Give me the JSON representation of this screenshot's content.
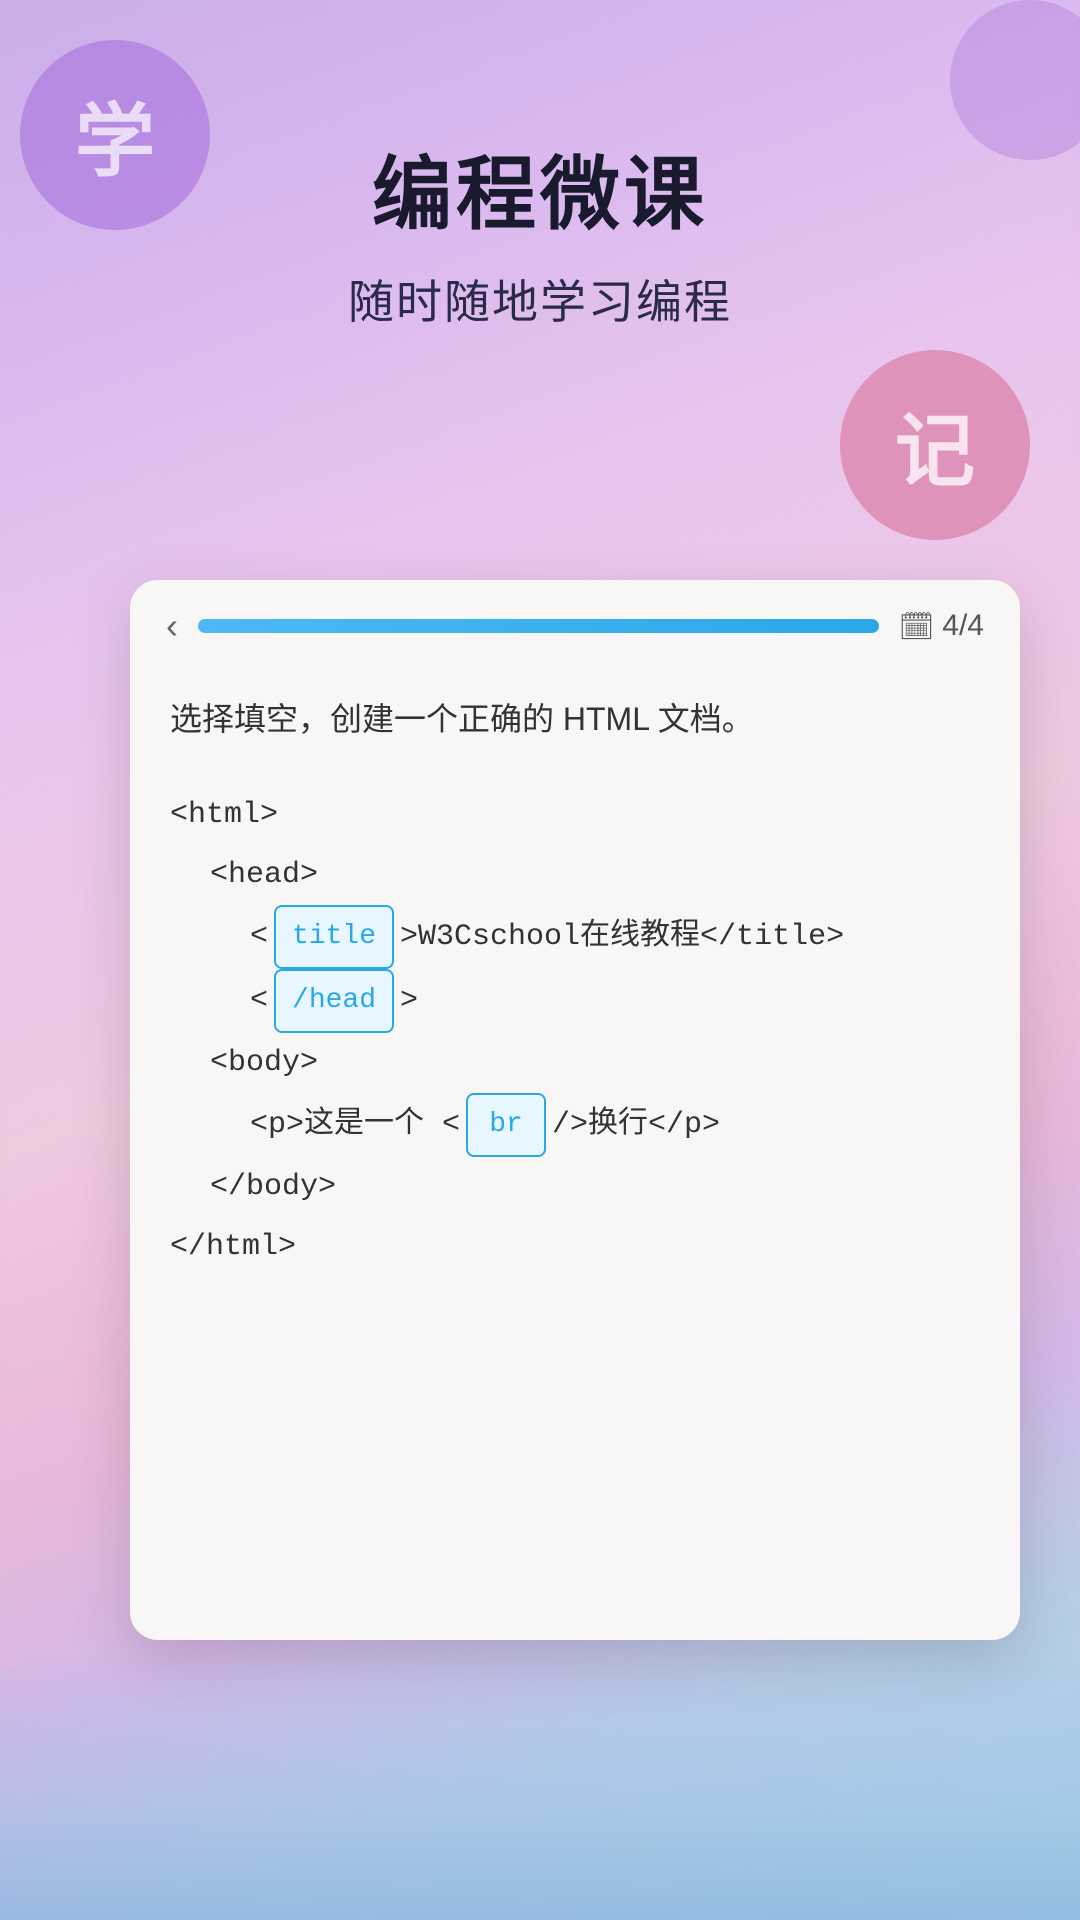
{
  "app": {
    "main_title": "编程微课",
    "sub_title": "随时随地学习编程",
    "circle_left_char": "学",
    "circle_right_char": "记"
  },
  "card": {
    "back_icon": "‹",
    "progress_percent": 100,
    "page_current": "4",
    "page_total": "4",
    "page_label": "4/4",
    "question": "选择填空，创建一个正确的 HTML 文档。",
    "code_lines": [
      {
        "indent": 0,
        "parts": [
          {
            "type": "text",
            "value": "<html>"
          }
        ]
      },
      {
        "indent": 1,
        "parts": [
          {
            "type": "text",
            "value": "<head>"
          }
        ]
      },
      {
        "indent": 2,
        "parts": [
          {
            "type": "text",
            "value": "<"
          },
          {
            "type": "badge",
            "value": "title"
          },
          {
            "type": "text",
            "value": ">W3Cschool在线教程</title>"
          }
        ]
      },
      {
        "indent": 2,
        "parts": [
          {
            "type": "text",
            "value": "<"
          },
          {
            "type": "badge",
            "value": "/head"
          },
          {
            "type": "text",
            "value": ">"
          }
        ]
      },
      {
        "indent": 1,
        "parts": [
          {
            "type": "text",
            "value": "<body>"
          }
        ]
      },
      {
        "indent": 2,
        "parts": [
          {
            "type": "text",
            "value": "<p>这是一个 <"
          },
          {
            "type": "badge",
            "value": "br"
          },
          {
            "type": "text",
            "value": "/>换行</p>"
          }
        ]
      },
      {
        "indent": 1,
        "parts": [
          {
            "type": "text",
            "value": "</body>"
          }
        ]
      },
      {
        "indent": 0,
        "parts": [
          {
            "type": "text",
            "value": "</html>"
          }
        ]
      }
    ]
  },
  "colors": {
    "accent": "#29a8e8",
    "badge_border": "#29a8e8",
    "progress_fill": "#29a8e8"
  }
}
